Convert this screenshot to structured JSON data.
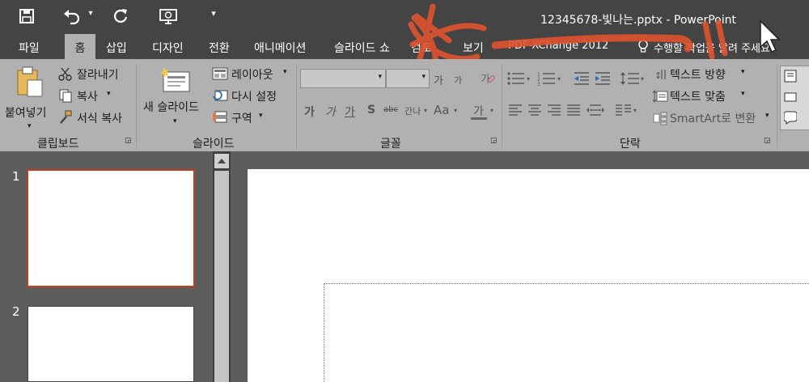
{
  "window": {
    "title": "12345678-빛나는.pptx - PowerPoint"
  },
  "qat": {
    "customize_glyph": "▾"
  },
  "tabs": [
    {
      "label": "파일"
    },
    {
      "label": "홈"
    },
    {
      "label": "삽입"
    },
    {
      "label": "디자인"
    },
    {
      "label": "전환"
    },
    {
      "label": "애니메이션"
    },
    {
      "label": "슬라이드 쇼"
    },
    {
      "label": "검토"
    },
    {
      "label": "보기"
    },
    {
      "label": "PDF-XChange 2012"
    }
  ],
  "tell_me": {
    "placeholder": "수행할 작업을 알려 주세요."
  },
  "ribbon": {
    "clipboard": {
      "paste_label": "붙여넣기",
      "cut_label": "잘라내기",
      "copy_label": "복사",
      "format_painter_label": "서식 복사",
      "group_label": "클립보드"
    },
    "slides": {
      "new_slide_label": "새 슬라이드",
      "layout_label": "레이아웃",
      "reset_label": "다시 설정",
      "section_label": "구역",
      "group_label": "슬라이드"
    },
    "font": {
      "grow_label": "가",
      "shrink_label": "가",
      "bold_label": "가",
      "italic_label": "가",
      "underline_label": "가",
      "shadow_label": "S",
      "strike_label": "abc",
      "spacing_label": "간나",
      "case_label": "Aa",
      "color_label": "가",
      "group_label": "글꼴"
    },
    "paragraph": {
      "text_direction_label": "텍스트 방향",
      "align_text_label": "텍스트 맞춤",
      "smartart_label": "SmartArt로 변환",
      "group_label": "단락"
    }
  },
  "thumbnails": [
    {
      "number": "1"
    },
    {
      "number": "2"
    }
  ],
  "colors": {
    "accent": "#c43e1c",
    "titlebar": "#444444",
    "ribbon": "#b1b1b1",
    "annotation": "#e0532e"
  }
}
